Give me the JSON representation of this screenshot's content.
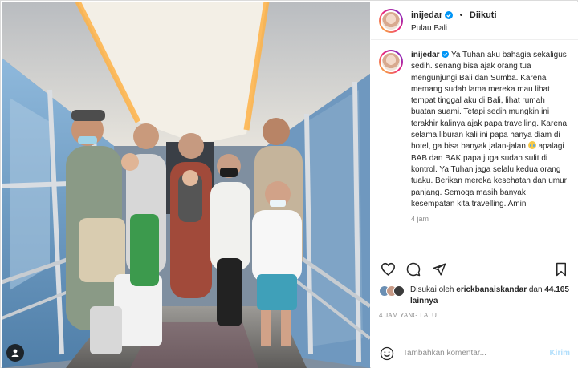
{
  "post": {
    "username": "inijedar",
    "follow_status": "Diikuti",
    "location": "Pulau Bali"
  },
  "caption": {
    "username": "inijedar",
    "text_part1": "Ya Tuhan aku bahagia sekaligus sedih. senang bisa ajak orang tua mengunjungi Bali dan Sumba. Karena memang sudah lama mereka mau lihat tempat tinggal aku di Bali, lihat rumah buatan suami. Tetapi sedih mungkin ini terakhir kalinya ajak papa travelling. Karena selama liburan kali ini papa hanya diam di hotel, ga bisa banyak jalan-jalan",
    "text_part2": "apalagi BAB dan BAK papa juga sudah sulit di kontrol. Ya Tuhan jaga selalu kedua orang tuaku. Berikan mereka kesehatan dan umur panjang. Semoga masih banyak kesempatan kita travelling. Amin",
    "time": "4 jam"
  },
  "likes": {
    "prefix": "Disukai oleh",
    "liker": "erickbanaiskandar",
    "conjunction": "dan",
    "count": "44.165 lainnya"
  },
  "post_date": "4 JAM YANG LALU",
  "comment": {
    "placeholder": "Tambahkan komentar...",
    "send_label": "Kirim"
  },
  "icons": {
    "like": "heart-icon",
    "comment": "comment-icon",
    "share": "share-icon",
    "save": "bookmark-icon",
    "emoji": "smile-icon",
    "tag": "user-tag-icon",
    "verified": "verified-badge-icon"
  },
  "colors": {
    "verified_blue": "#0095f6",
    "send_disabled": "#b2dffc",
    "secondary_text": "#8e8e8e"
  }
}
